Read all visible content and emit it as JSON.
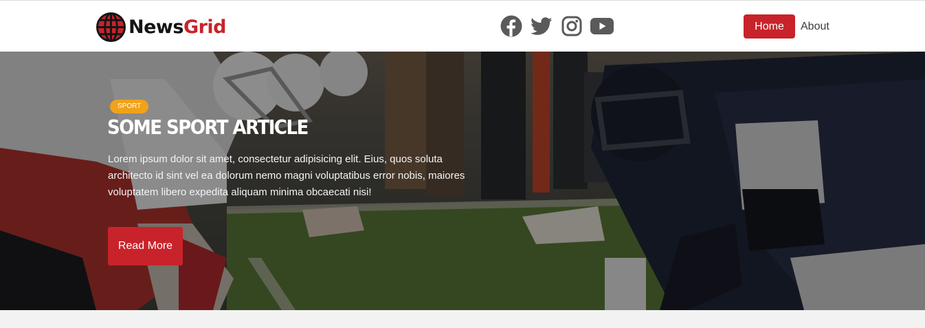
{
  "brand": {
    "part1": "News",
    "part2": "Grid"
  },
  "social": {
    "icons": [
      "facebook-icon",
      "twitter-icon",
      "instagram-icon",
      "youtube-icon"
    ],
    "color": "#5a5a5a"
  },
  "nav": {
    "home": "Home",
    "about": "About",
    "active_color": "#c8232b"
  },
  "hero": {
    "category": "Sport",
    "category_color": "#f0a21a",
    "title": "Some Sport Article",
    "text": "Lorem ipsum dolor sit amet, consectetur adipisicing elit. Eius, quos soluta architecto id sint vel ea dolorum nemo magni voluptatibus error nobis, maiores voluptatem libero expedita aliquam minima obcaecati nisi!",
    "button": "Read More"
  }
}
